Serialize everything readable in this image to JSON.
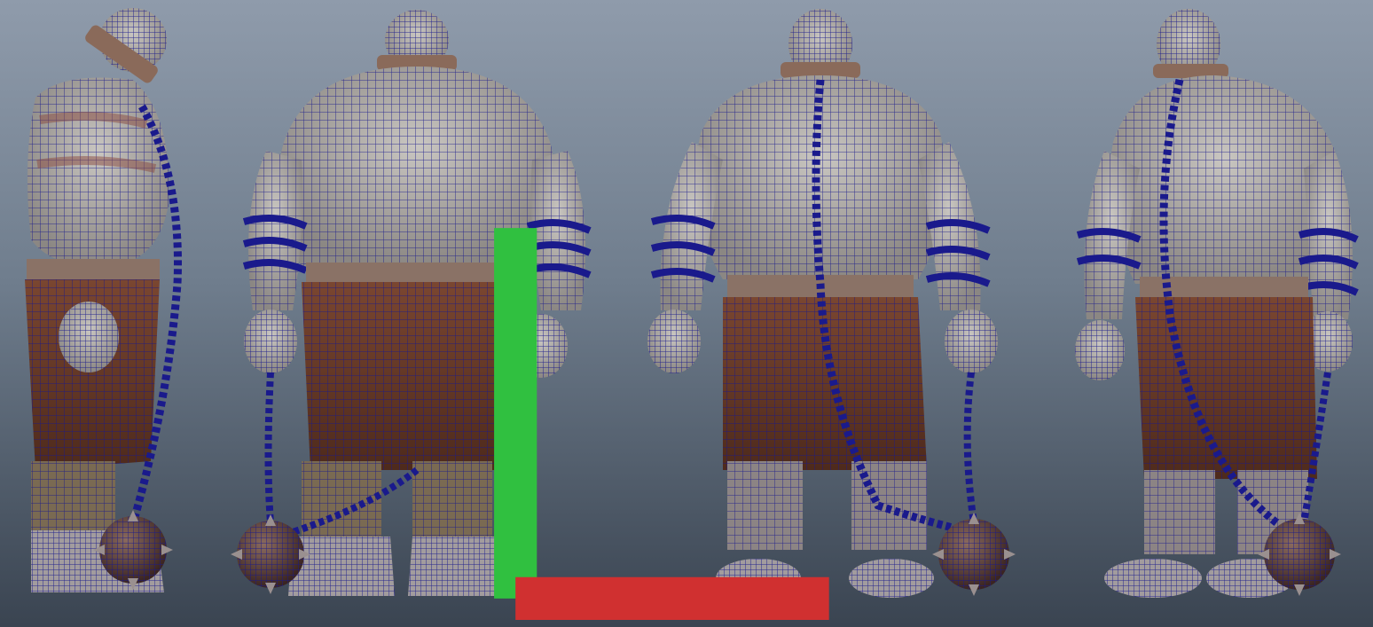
{
  "viewport": {
    "background_top": "#8f9bab",
    "background_bottom": "#3a4451",
    "wireframe_color": "#1a1a8c",
    "skin_color": "#b9b7b3",
    "pants_color": "#6b3a26",
    "boot_color": "#9a9496",
    "strap_color": "#7a5a4a"
  },
  "scene": {
    "character_views": [
      {
        "view": "side-left"
      },
      {
        "view": "back"
      },
      {
        "view": "front"
      },
      {
        "view": "three-quarter"
      }
    ]
  },
  "axis_gizmo": {
    "x_color": "#d03030",
    "y_color": "#30c040"
  }
}
